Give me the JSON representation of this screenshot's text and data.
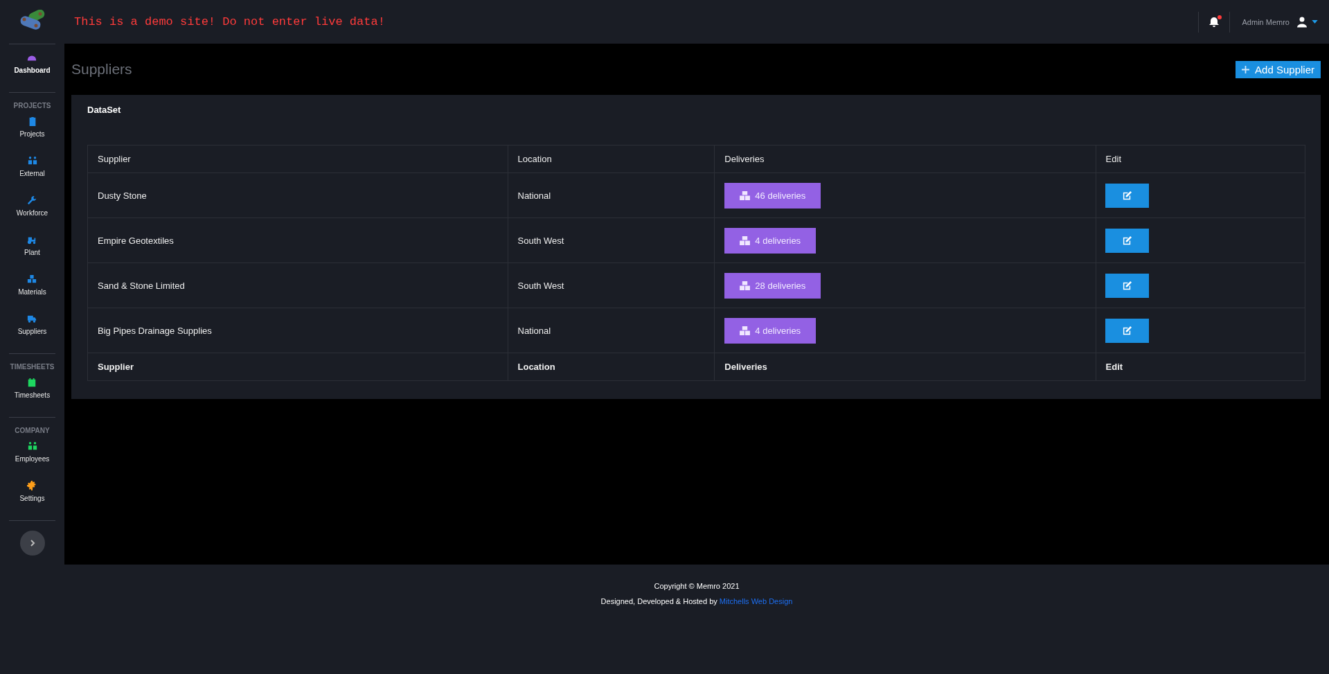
{
  "topbar": {
    "notice": "This is a demo site! Do not enter live data!",
    "notifications": {
      "unread": true
    },
    "user": {
      "name": "Admin Memro"
    }
  },
  "sidebar": {
    "groups": [
      {
        "items": [
          {
            "label": "Dashboard",
            "color": "#9b5de5",
            "selected": true
          }
        ]
      },
      {
        "heading": "PROJECTS",
        "items": [
          {
            "label": "Projects",
            "color": "#1e88e5",
            "selected": false
          },
          {
            "label": "External",
            "color": "#1e88e5",
            "selected": false
          },
          {
            "label": "Workforce",
            "color": "#1e88e5",
            "selected": false
          },
          {
            "label": "Plant",
            "color": "#1e88e5",
            "selected": false
          },
          {
            "label": "Materials",
            "color": "#1e88e5",
            "selected": false
          },
          {
            "label": "Suppliers",
            "color": "#1e88e5",
            "selected": false
          }
        ]
      },
      {
        "heading": "TIMESHEETS",
        "items": [
          {
            "label": "Timesheets",
            "color": "#1ed760",
            "selected": false
          }
        ]
      },
      {
        "heading": "COMPANY",
        "items": [
          {
            "label": "Employees",
            "color": "#1ed760",
            "selected": false
          },
          {
            "label": "Settings",
            "color": "#ff9f1a",
            "selected": false
          }
        ]
      }
    ]
  },
  "page": {
    "title": "Suppliers",
    "add_button": "Add Supplier"
  },
  "card": {
    "title": "DataSet",
    "table": {
      "columns": [
        "Supplier",
        "Location",
        "Deliveries",
        "Edit"
      ],
      "rows": [
        {
          "supplier": "Dusty Stone",
          "location": "National",
          "deliveries": "46 deliveries"
        },
        {
          "supplier": "Empire Geotextiles",
          "location": "South West",
          "deliveries": "4 deliveries"
        },
        {
          "supplier": "Sand & Stone Limited",
          "location": "South West",
          "deliveries": "28 deliveries"
        },
        {
          "supplier": "Big Pipes Drainage Supplies",
          "location": "National",
          "deliveries": "4 deliveries"
        }
      ],
      "footer": [
        "Supplier",
        "Location",
        "Deliveries",
        "Edit"
      ]
    }
  },
  "footer": {
    "copyright": "Copyright © Memro 2021",
    "credit": "Designed, Developed & Hosted by",
    "link": "Mitchells Web Design"
  }
}
